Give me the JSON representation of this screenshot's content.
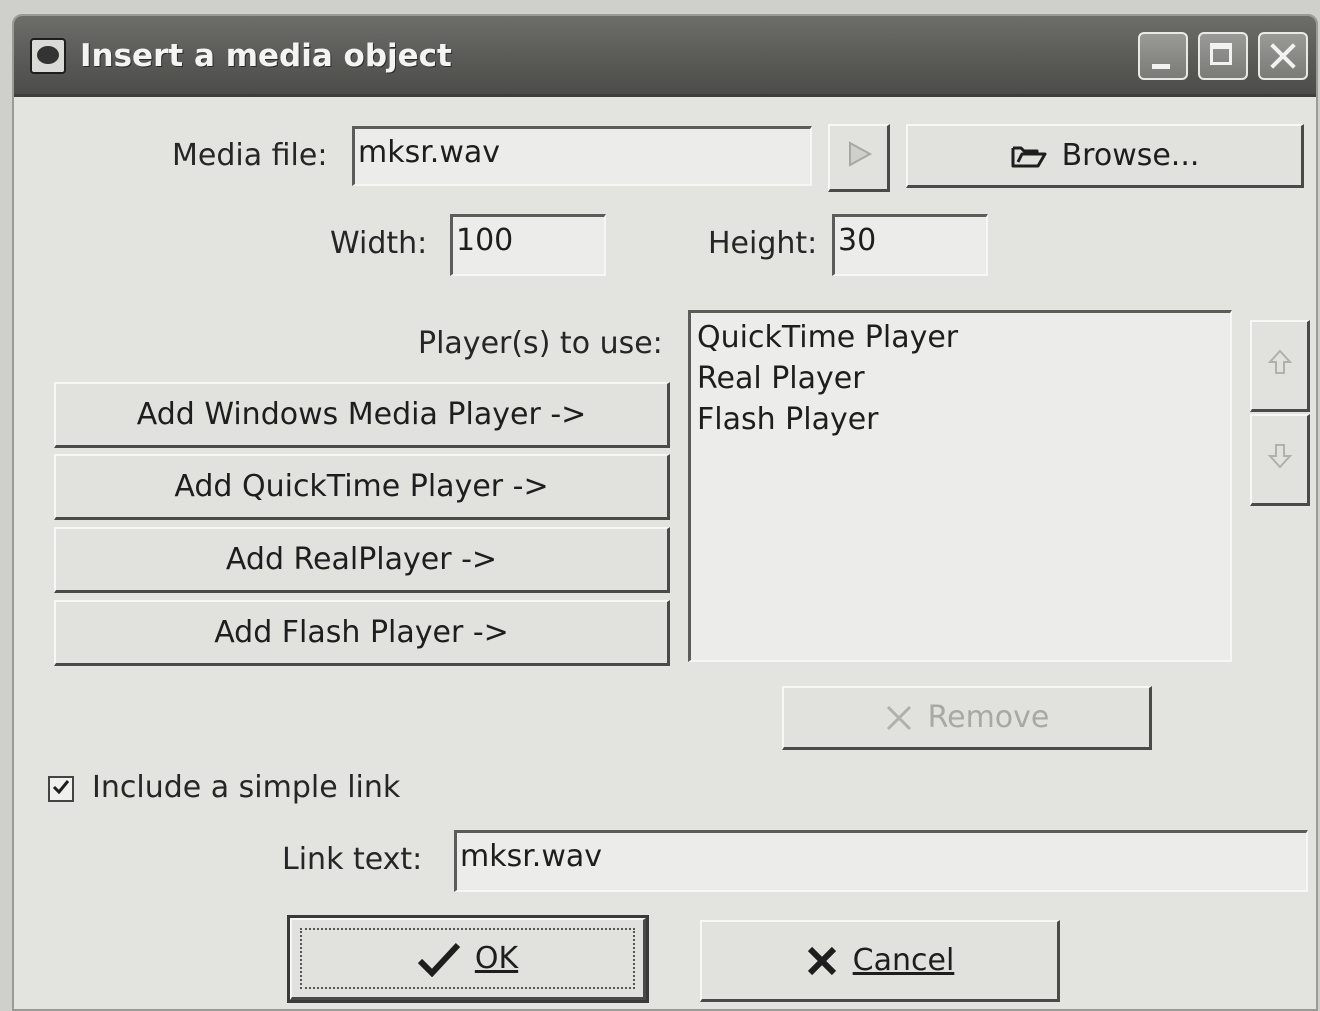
{
  "window": {
    "title": "Insert a media object"
  },
  "media": {
    "label": "Media file:",
    "value": "mksr.wav",
    "browse_label": "Browse..."
  },
  "size": {
    "width_label": "Width:",
    "width_value": "100",
    "height_label": "Height:",
    "height_value": "30"
  },
  "players": {
    "label": "Player(s) to use:",
    "add_buttons": [
      "Add Windows Media Player ->",
      "Add QuickTime Player ->",
      "Add RealPlayer ->",
      "Add Flash Player ->"
    ],
    "list": [
      "QuickTime Player",
      "Real Player",
      "Flash Player"
    ],
    "remove_label": "Remove"
  },
  "link": {
    "checkbox_label": "Include a simple link",
    "checked": true,
    "text_label": "Link text:",
    "text_value": "mksr.wav"
  },
  "footer": {
    "ok_label": "OK",
    "cancel_label": "Cancel"
  },
  "icons": {
    "play": "play-icon",
    "browse": "folder-open-icon",
    "up": "arrow-up-icon",
    "down": "arrow-down-icon",
    "remove": "x-icon",
    "ok": "checkmark-icon",
    "cancel": "x-icon",
    "checkbox": "checkmark-icon"
  }
}
